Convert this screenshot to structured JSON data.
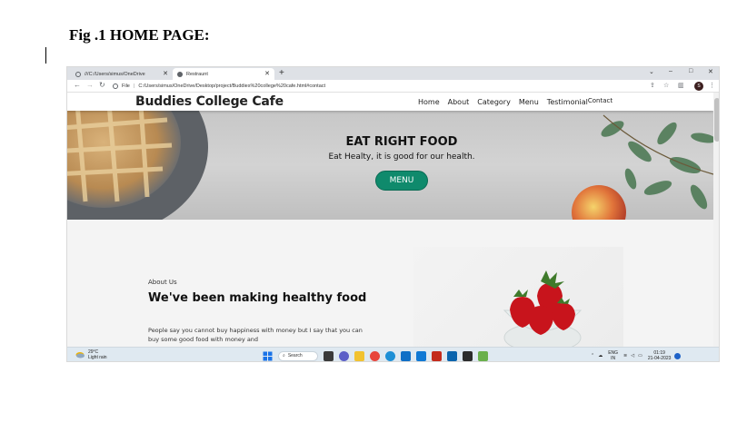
{
  "document": {
    "caption": "Fig .1 HOME PAGE:"
  },
  "browser": {
    "tabs": [
      {
        "title": "///C:/Users/simus/OneDrive",
        "active": false
      },
      {
        "title": "Restraunt",
        "active": true
      }
    ],
    "new_tab": "+",
    "address": "C:/Users/simus/OneDrive/Desktop/project/Buddies%20college%20cafe.html#contact",
    "address_prefix": "File",
    "avatar_letter": "S",
    "window_controls": [
      "⌄",
      "–",
      "□",
      "✕"
    ],
    "nav_icons": [
      "←",
      "→",
      "↻"
    ]
  },
  "site": {
    "brand": "Buddies College Cafe",
    "nav": [
      "Home",
      "About",
      "Category",
      "Menu",
      "Testimonial",
      "Contact"
    ],
    "hero": {
      "title": "EAT RIGHT FOOD",
      "subtitle": "Eat Healty, it is good for our health.",
      "button": "MENU",
      "button_color": "#0f8a6c"
    },
    "about": {
      "kicker": "About Us",
      "title": "We've been making healthy food",
      "body": "People say you cannot buy happiness with money but I say that you can buy some good food with money and"
    }
  },
  "taskbar": {
    "weather_temp": "29°C",
    "weather_desc": "Light rain",
    "search_label": "Search",
    "lang_top": "ENG",
    "lang_bottom": "IN",
    "time": "01:19",
    "date": "21-04-2023"
  }
}
